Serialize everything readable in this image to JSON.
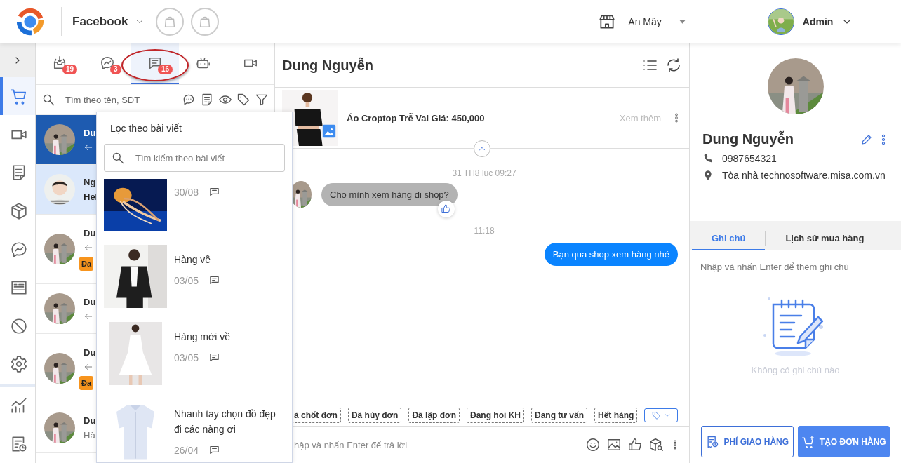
{
  "topbar": {
    "channel": "Facebook",
    "store": "An Mây",
    "user": "Admin"
  },
  "sidebar": {
    "items": [
      {
        "selected": true
      },
      {
        "selected": false
      },
      {
        "selected": false
      },
      {
        "selected": false
      },
      {
        "selected": false
      },
      {
        "selected": false
      },
      {
        "selected": false
      },
      {
        "selected": false
      },
      {
        "selected": false
      },
      {
        "selected": false
      }
    ]
  },
  "inbox_tabs": [
    {
      "badge": "19",
      "selected": false,
      "highlighted": false
    },
    {
      "badge": "3",
      "selected": false,
      "highlighted": false
    },
    {
      "badge": "16",
      "selected": true,
      "highlighted": true
    },
    {
      "selected": false,
      "highlighted": false
    },
    {
      "selected": false,
      "highlighted": false
    }
  ],
  "search": {
    "placeholder": "Tìm theo tên, SĐT"
  },
  "conversations": [
    {
      "name": "Du",
      "selected": true,
      "unread": false,
      "replied": true
    },
    {
      "name": "Ng",
      "message": "Hel",
      "selected": false,
      "unread": true,
      "replied": false
    },
    {
      "name": "Du",
      "selected": false,
      "unread": false,
      "replied": true,
      "tag": "Đa"
    },
    {
      "name": "Du",
      "selected": false,
      "unread": false,
      "replied": true
    },
    {
      "name": "Du",
      "selected": false,
      "unread": false,
      "replied": true,
      "tag": "Đa"
    },
    {
      "name": "Du",
      "message": "Hà",
      "selected": false,
      "unread": false,
      "replied": false
    }
  ],
  "post_filter": {
    "title": "Lọc theo bài viết",
    "placeholder": "Tìm kiếm theo bài viết",
    "posts": [
      {
        "date": "30/08"
      },
      {
        "title": "Hàng về",
        "date": "03/05"
      },
      {
        "title": "Hàng mới về",
        "date": "03/05"
      },
      {
        "title": "Nhanh tay chọn đồ đẹp đi các nàng ơi",
        "date": "26/04"
      }
    ]
  },
  "chat": {
    "contact": "Dung Nguyễn",
    "product": {
      "title": "Áo Croptop Trễ Vai Giá: 450,000",
      "more": "Xem thêm"
    },
    "messages": [
      {
        "kind": "time",
        "text": "31 TH8 lúc 09:27"
      },
      {
        "kind": "incoming",
        "text": "Cho mình xem hàng đi shop?",
        "liked": true
      },
      {
        "kind": "time",
        "text": "11:18"
      },
      {
        "kind": "outgoing",
        "text": "Bạn qua shop xem hàng nhé"
      }
    ],
    "tags": [
      "ã chốt đơn",
      "Đã hủy đơn",
      "Đã lập đơn",
      "Đang hỏi KH",
      "Đang tư vấn",
      "Hết hàng"
    ],
    "reply_placeholder": "hập và nhấn Enter để trả lời"
  },
  "profile": {
    "name": "Dung Nguyễn",
    "phone": "0987654321",
    "address": "Tòa nhà technosoftware.misa.com.vn",
    "tabs": [
      {
        "label": "Ghi chú",
        "selected": true
      },
      {
        "label": "Lịch sử mua hàng",
        "selected": false
      }
    ],
    "note_placeholder": "Nhập và nhấn Enter để thêm ghi chú",
    "empty_text": "Không có ghi chú nào",
    "buttons": [
      {
        "kind": "outline",
        "label": "PHÍ GIAO HÀNG"
      },
      {
        "kind": "primary",
        "label": "TẠO ĐƠN HÀNG"
      }
    ]
  }
}
